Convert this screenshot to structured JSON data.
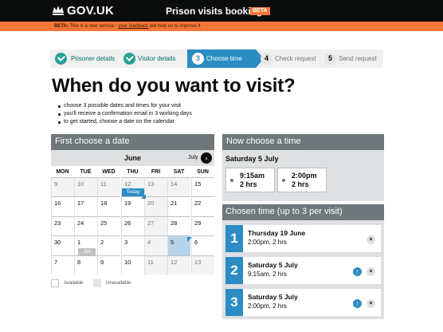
{
  "header": {
    "brand": "GOV.UK",
    "service": "Prison visits booking",
    "beta_tag": "BETA"
  },
  "beta_banner": {
    "prefix": "BETA:",
    "text_before": "This is a new service -",
    "link": "your feedback",
    "text_after": "will help us to improve it"
  },
  "steps": [
    {
      "num": "",
      "label": "Prisoner details",
      "state": "done"
    },
    {
      "num": "",
      "label": "Visitor details",
      "state": "done"
    },
    {
      "num": "3",
      "label": "Choose time",
      "state": "current"
    },
    {
      "num": "4",
      "label": "Check request",
      "state": "todo"
    },
    {
      "num": "5",
      "label": "Send request",
      "state": "todo"
    }
  ],
  "page_title": "When do you want to visit?",
  "bullets": [
    "choose 3 possible dates and times for your visit",
    "you'll receive a confirmation email in 3 working days",
    "to get started, choose a date on the calendar"
  ],
  "calendar": {
    "title": "First choose a date",
    "month": "June",
    "next_label": "July",
    "next_icon": "chevron-right-icon",
    "days_of_week": [
      "MON",
      "TUE",
      "WED",
      "THU",
      "FRI",
      "SAT",
      "SUN"
    ],
    "today_label": "Today",
    "month_badge": "Jul",
    "weeks": [
      [
        "9",
        "10",
        "11",
        "12",
        "13",
        "14",
        "15"
      ],
      [
        "16",
        "17",
        "18",
        "19",
        "20",
        "21",
        "22"
      ],
      [
        "23",
        "24",
        "25",
        "26",
        "27",
        "28",
        "29"
      ],
      [
        "30",
        "1",
        "2",
        "3",
        "4",
        "5",
        "6"
      ],
      [
        "7",
        "8",
        "9",
        "10",
        "11",
        "12",
        "13"
      ]
    ],
    "legend_available": "Available",
    "legend_unavailable": "Unavailable"
  },
  "now_choose": {
    "title": "Now choose a time",
    "date": "Saturday 5 July",
    "slots": [
      {
        "time": "9:15am",
        "duration": "2 hrs"
      },
      {
        "time": "2:00pm",
        "duration": "2 hrs"
      }
    ]
  },
  "chosen": {
    "title": "Chosen time (up to 3 per visit)",
    "items": [
      {
        "num": "1",
        "day": "Thursday 19 June",
        "time": "2:00pm, 2 hrs",
        "up": false
      },
      {
        "num": "2",
        "day": "Saturday 5 July",
        "time": "9:15am, 2 hrs",
        "up": true
      },
      {
        "num": "3",
        "day": "Saturday 5 July",
        "time": "2:00pm, 2 hrs",
        "up": true
      }
    ],
    "up_icon": "↑",
    "remove_icon": "×"
  },
  "colors": {
    "header_bg": "#0b0c0c",
    "beta_orange": "#f47738",
    "accent_blue": "#2b8cc4",
    "done_green": "#28a197",
    "panel_grey": "#6f777b"
  }
}
